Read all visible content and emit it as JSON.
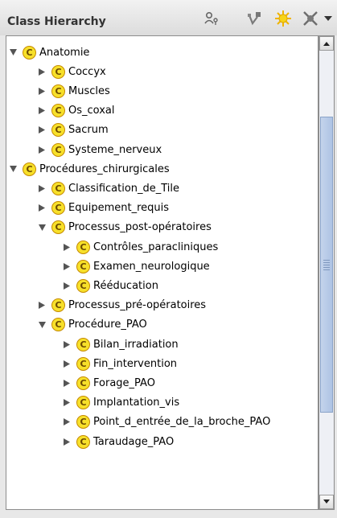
{
  "panel": {
    "title": "Class Hierarchy"
  },
  "toolbar": {
    "icons": [
      "person-graph-icon",
      "subclass-icon",
      "create-class-icon",
      "delete-class-icon",
      "menu-down-icon"
    ]
  },
  "colors": {
    "badge_fill": "#f7e02a",
    "badge_border": "#c58a00",
    "thumb": "#aec3e4"
  },
  "tree": {
    "badge_letter": "C",
    "rows": [
      {
        "label": "Anatomie",
        "level": 0,
        "state": "expanded"
      },
      {
        "label": "Coccyx",
        "level": 1,
        "state": "collapsed"
      },
      {
        "label": "Muscles",
        "level": 1,
        "state": "collapsed"
      },
      {
        "label": "Os_coxal",
        "level": 1,
        "state": "collapsed"
      },
      {
        "label": "Sacrum",
        "level": 1,
        "state": "collapsed"
      },
      {
        "label": "Systeme_nerveux",
        "level": 1,
        "state": "collapsed"
      },
      {
        "label": "Procédures_chirurgicales",
        "level": 0,
        "state": "expanded"
      },
      {
        "label": "Classification_de_Tile",
        "level": 1,
        "state": "collapsed"
      },
      {
        "label": "Equipement_requis",
        "level": 1,
        "state": "collapsed"
      },
      {
        "label": "Processus_post-opératoires",
        "level": 1,
        "state": "expanded"
      },
      {
        "label": "Contrôles_paracliniques",
        "level": 2,
        "state": "collapsed"
      },
      {
        "label": "Examen_neurologique",
        "level": 2,
        "state": "collapsed"
      },
      {
        "label": "Rééducation",
        "level": 2,
        "state": "collapsed"
      },
      {
        "label": "Processus_pré-opératoires",
        "level": 1,
        "state": "collapsed"
      },
      {
        "label": "Procédure_PAO",
        "level": 1,
        "state": "expanded"
      },
      {
        "label": "Bilan_irradiation",
        "level": 2,
        "state": "collapsed"
      },
      {
        "label": "Fin_intervention",
        "level": 2,
        "state": "collapsed"
      },
      {
        "label": "Forage_PAO",
        "level": 2,
        "state": "collapsed"
      },
      {
        "label": "Implantation_vis",
        "level": 2,
        "state": "collapsed"
      },
      {
        "label": "Point_d_entrée_de_la_broche_PAO",
        "level": 2,
        "state": "collapsed"
      },
      {
        "label": "Taraudage_PAO",
        "level": 2,
        "state": "collapsed"
      }
    ]
  }
}
